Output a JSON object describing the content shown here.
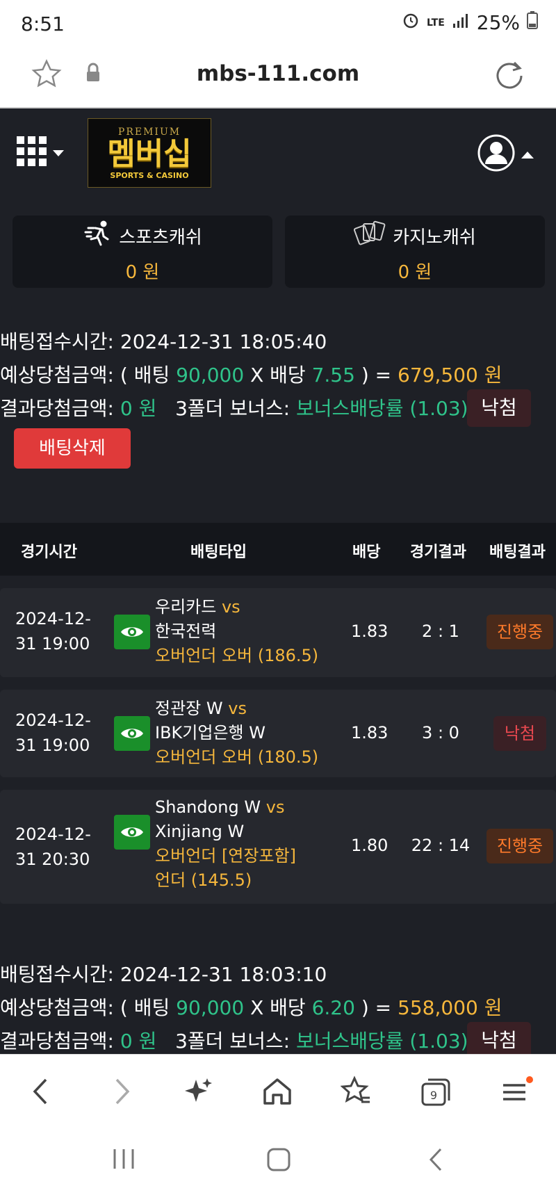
{
  "status_bar": {
    "time": "8:51",
    "network": "LTE",
    "battery": "25%"
  },
  "browser": {
    "url": "mbs-111.com"
  },
  "logo": {
    "premium": "PREMIUM",
    "main": "멤버십",
    "sub": "SPORTS & CASINO"
  },
  "cash": {
    "sports_label": "스포츠캐쉬",
    "sports_amount": "0 원",
    "casino_label": "카지노캐쉬",
    "casino_amount": "0 원"
  },
  "bets": [
    {
      "time_label": "배팅접수시간:",
      "time": "2024-12-31 18:05:40",
      "expected_label": "예상당첨금액:",
      "paren_open": "( 배팅",
      "stake": "90,000",
      "times_label": "X 배당",
      "odds": "7.55",
      "equals": ") =",
      "payout": "679,500 원",
      "result_label": "결과당첨금액:",
      "result_amount": "0 원",
      "bonus_label": "3폴더 보너스:",
      "bonus_value": "보너스배당률 (1.03)",
      "status": "낙첨",
      "delete_label": "배팅삭제"
    },
    {
      "time_label": "배팅접수시간:",
      "time": "2024-12-31 18:03:10",
      "expected_label": "예상당첨금액:",
      "paren_open": "( 배팅",
      "stake": "90,000",
      "times_label": "X 배당",
      "odds": "6.20",
      "equals": ") =",
      "payout": "558,000 원",
      "result_label": "결과당첨금액:",
      "result_amount": "0 원",
      "bonus_label": "3폴더 보너스:",
      "bonus_value": "보너스배당률 (1.03)",
      "status": "낙첨"
    }
  ],
  "table": {
    "headers": [
      "경기시간",
      "배팅타입",
      "배당",
      "경기결과",
      "배팅결과"
    ],
    "rows": [
      {
        "date1": "2024-12-",
        "date2": "31 19:00",
        "home": "우리카드",
        "vs": "vs",
        "away": "한국전력",
        "type1": "오버언더 오버 (186.5)",
        "type2": "",
        "odds": "1.83",
        "score": "2 : 1",
        "result": "진행중"
      },
      {
        "date1": "2024-12-",
        "date2": "31 19:00",
        "home": "정관장 W",
        "vs": "vs",
        "away": "IBK기업은행 W",
        "type1": "오버언더 오버 (180.5)",
        "type2": "",
        "odds": "1.83",
        "score": "3 : 0",
        "result": "낙첨"
      },
      {
        "date1": "2024-12-",
        "date2": "31 20:30",
        "home": "Shandong W",
        "vs": "vs",
        "away": "Xinjiang W",
        "type1": "오버언더 [연장포함]",
        "type2": "언더 (145.5)",
        "odds": "1.80",
        "score": "22 : 14",
        "result": "진행중"
      }
    ]
  },
  "colors": {
    "accent_green": "#2fc38a",
    "accent_orange": "#f6b73c",
    "danger": "#e03a3a",
    "bg": "#1e2026"
  }
}
